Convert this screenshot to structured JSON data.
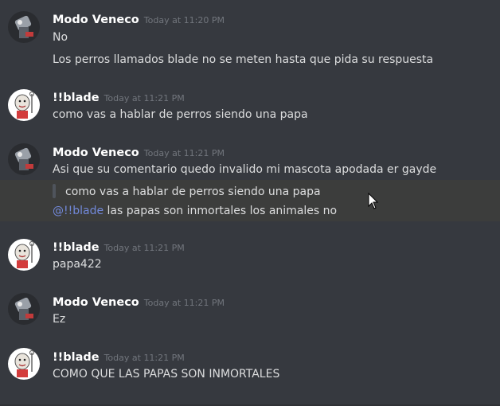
{
  "colors": {
    "background": "#36393f",
    "username": "#ffffff",
    "timestamp": "#72767d",
    "message_text": "#dcddde",
    "mention": "#7289da",
    "highlight": "#3c3d3c",
    "quote_bar": "#4f545c"
  },
  "messages": [
    {
      "author": "Modo Veneco",
      "timestamp": "Today at 11:20 PM",
      "avatar_icon": "veneco-avatar-icon",
      "lines": [
        "No",
        "Los perros llamados blade no se meten hasta que pida su respuesta"
      ]
    },
    {
      "author": "!!blade",
      "timestamp": "Today at 11:21 PM",
      "avatar_icon": "blade-avatar-icon",
      "lines": [
        "como vas a hablar de perros siendo una papa"
      ]
    },
    {
      "author": "Modo Veneco",
      "timestamp": "Today at 11:21 PM",
      "avatar_icon": "veneco-avatar-icon",
      "lines": [
        "Asi que su comentario quedo invalido mi mascota apodada er gayde"
      ],
      "quote": "como vas a hablar de perros siendo una papa",
      "mention": "@!!blade",
      "mention_text": " las papas son inmortales los animales no"
    },
    {
      "author": "!!blade",
      "timestamp": "Today at 11:21 PM",
      "avatar_icon": "blade-avatar-icon",
      "lines": [
        "papa422"
      ]
    },
    {
      "author": "Modo Veneco",
      "timestamp": "Today at 11:21 PM",
      "avatar_icon": "veneco-avatar-icon",
      "lines": [
        "Ez"
      ]
    },
    {
      "author": "!!blade",
      "timestamp": "Today at 11:21 PM",
      "avatar_icon": "blade-avatar-icon",
      "lines": [
        "COMO QUE LAS PAPAS SON INMORTALES"
      ]
    }
  ]
}
